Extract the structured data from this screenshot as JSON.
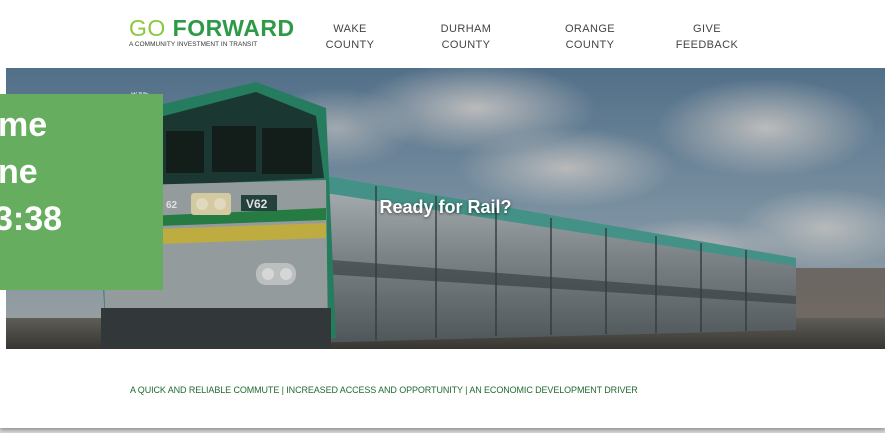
{
  "header": {
    "logo": {
      "title_go": "GO",
      "title_forward": "FORWARD",
      "subtitle": "A COMMUNITY INVESTMENT IN TRANSIT"
    },
    "nav": [
      {
        "line1": "WAKE",
        "line2": "COUNTY"
      },
      {
        "line1": "DURHAM",
        "line2": "COUNTY"
      },
      {
        "line1": "ORANGE",
        "line2": "COUNTY"
      },
      {
        "line1": "GIVE",
        "line2": "FEEDBACK"
      }
    ]
  },
  "hero": {
    "breadcrumb": "HOME",
    "title": "Ready for Rail?",
    "train_number": "V62",
    "train_number_front": "62"
  },
  "overlay": {
    "lines": [
      "me",
      "ne",
      "3:38"
    ]
  },
  "tagline": "A QUICK AND RELIABLE COMMUTE | INCREASED ACCESS AND OPPORTUNITY | AN ECONOMIC DEVELOPMENT DRIVER",
  "colors": {
    "brand_green": "#2e9a47",
    "brand_light_green": "#8cc63f",
    "overlay_green": "#66ad5f",
    "tagline_green": "#226a2f"
  }
}
